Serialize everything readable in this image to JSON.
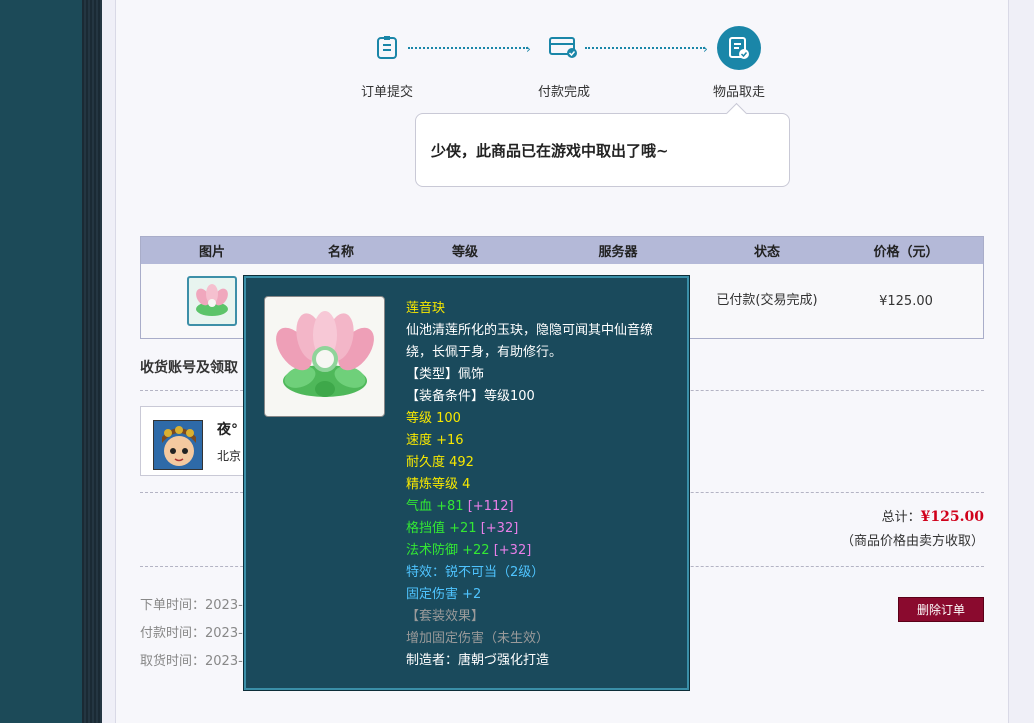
{
  "steps": [
    {
      "label": "订单提交",
      "icon": "document-icon"
    },
    {
      "label": "付款完成",
      "icon": "card-icon"
    },
    {
      "label": "物品取走",
      "icon": "document-check-icon"
    }
  ],
  "bubble_message": "少侠，此商品已在游戏中取出了哦~",
  "table": {
    "headers": [
      "图片",
      "名称",
      "等级",
      "服务器",
      "状态",
      "价格（元）"
    ],
    "row": {
      "status": "已付款(交易完成)",
      "price": "¥125.00"
    }
  },
  "receipt_section_title": "收货账号及领取",
  "account": {
    "name": "夜°",
    "server": "北京"
  },
  "total": {
    "label": "总计：",
    "amount": "¥125.00",
    "note": "（商品价格由卖方收取）"
  },
  "times": {
    "order": "下单时间：2023-",
    "paid": "付款时间：2023-",
    "taken": "取货时间：2023-"
  },
  "delete_button": "删除订单",
  "tooltip": {
    "name": "莲音玦",
    "desc": "仙池清莲所化的玉玦，隐隐可闻其中仙音缭绕，长佩于身，有助修行。",
    "type": "【类型】佩饰",
    "requirement": "【装备条件】等级100",
    "level": "等级 100",
    "speed": "速度 +16",
    "durability": "耐久度 492",
    "refine": "精炼等级 4",
    "hp_base": "气血 +81",
    "hp_bonus": "[+112]",
    "block_base": "格挡值 +21",
    "block_bonus": "[+32]",
    "mdef_base": "法术防御 +22",
    "mdef_bonus": "[+32]",
    "effect": "特效：锐不可当（2级）",
    "fixed_dmg": "固定伤害 +2",
    "set_title": "【套装效果】",
    "set_effect": "增加固定伤害（未生效）",
    "maker": "制造者：唐朝づ强化打造"
  },
  "colors": {
    "accent": "#1a86a8",
    "tooltip_bg": "#1a4a5c",
    "price_red": "#d0011b",
    "delete_btn": "#8a0a2e"
  }
}
